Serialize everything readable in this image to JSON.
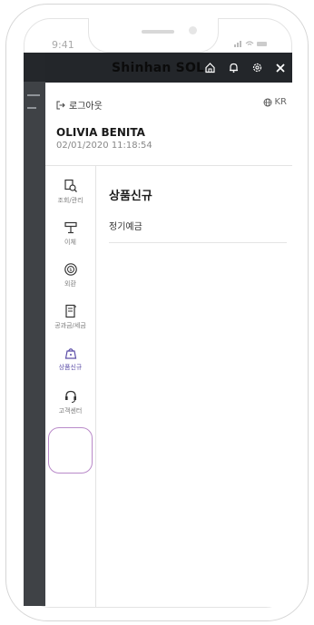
{
  "status": {
    "time": "9:41",
    "icons": "‥… ≋ ▬"
  },
  "topbar": {
    "brand": "Shinhan SOL",
    "brand_ghost": "┃┃┃"
  },
  "drawer": {
    "logout_label": "로그아웃",
    "language": "KR",
    "user_name": "OLIVIA BENITA",
    "last_login": "02/01/2020 11:18:54"
  },
  "nav": {
    "items": [
      {
        "label": "조회/관리",
        "icon": "inquiry-search-icon"
      },
      {
        "label": "이체",
        "icon": "transfer-icon"
      },
      {
        "label": "외환",
        "icon": "exchange-coin-icon"
      },
      {
        "label": "공과금/세금",
        "icon": "bill-document-icon"
      },
      {
        "label": "상품신규",
        "icon": "new-product-bag-icon"
      },
      {
        "label": "고객센터",
        "icon": "headset-icon"
      }
    ],
    "active_index": 4
  },
  "content": {
    "section_title": "상품신규",
    "items": [
      "정기예금"
    ]
  },
  "colors": {
    "topbar": "#23262a",
    "active_ring": "#b98ac9",
    "active_label": "#5d4fa8"
  }
}
